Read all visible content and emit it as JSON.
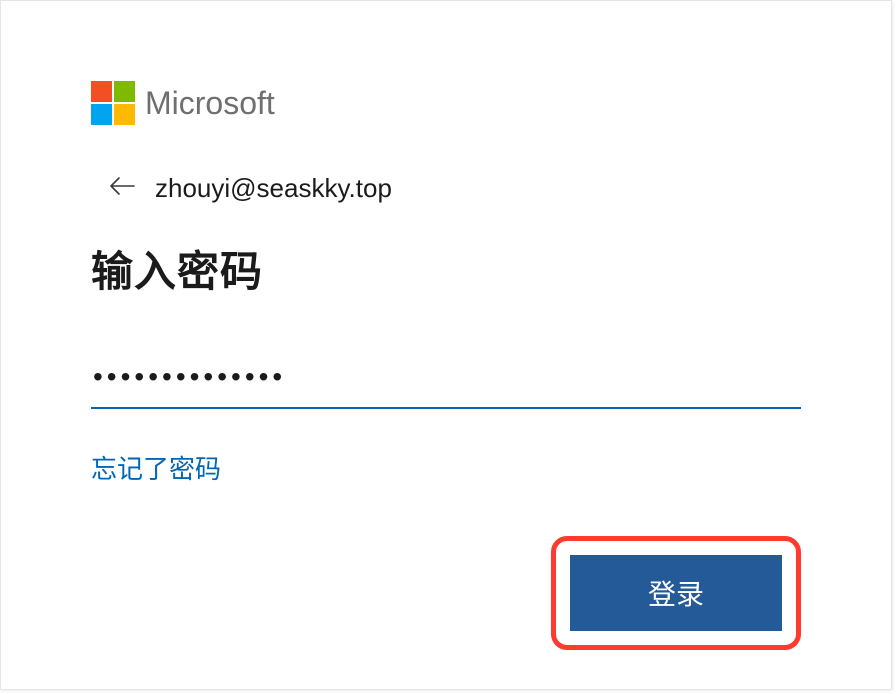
{
  "brand": {
    "name": "Microsoft"
  },
  "identity": {
    "email": "zhouyi@seaskky.top"
  },
  "heading": "输入密码",
  "password": {
    "value": "••••••••••••••"
  },
  "links": {
    "forgot": "忘记了密码"
  },
  "buttons": {
    "signin": "登录"
  },
  "colors": {
    "accent": "#0067b8",
    "button_bg": "#235a97",
    "highlight": "#ff3b30"
  }
}
